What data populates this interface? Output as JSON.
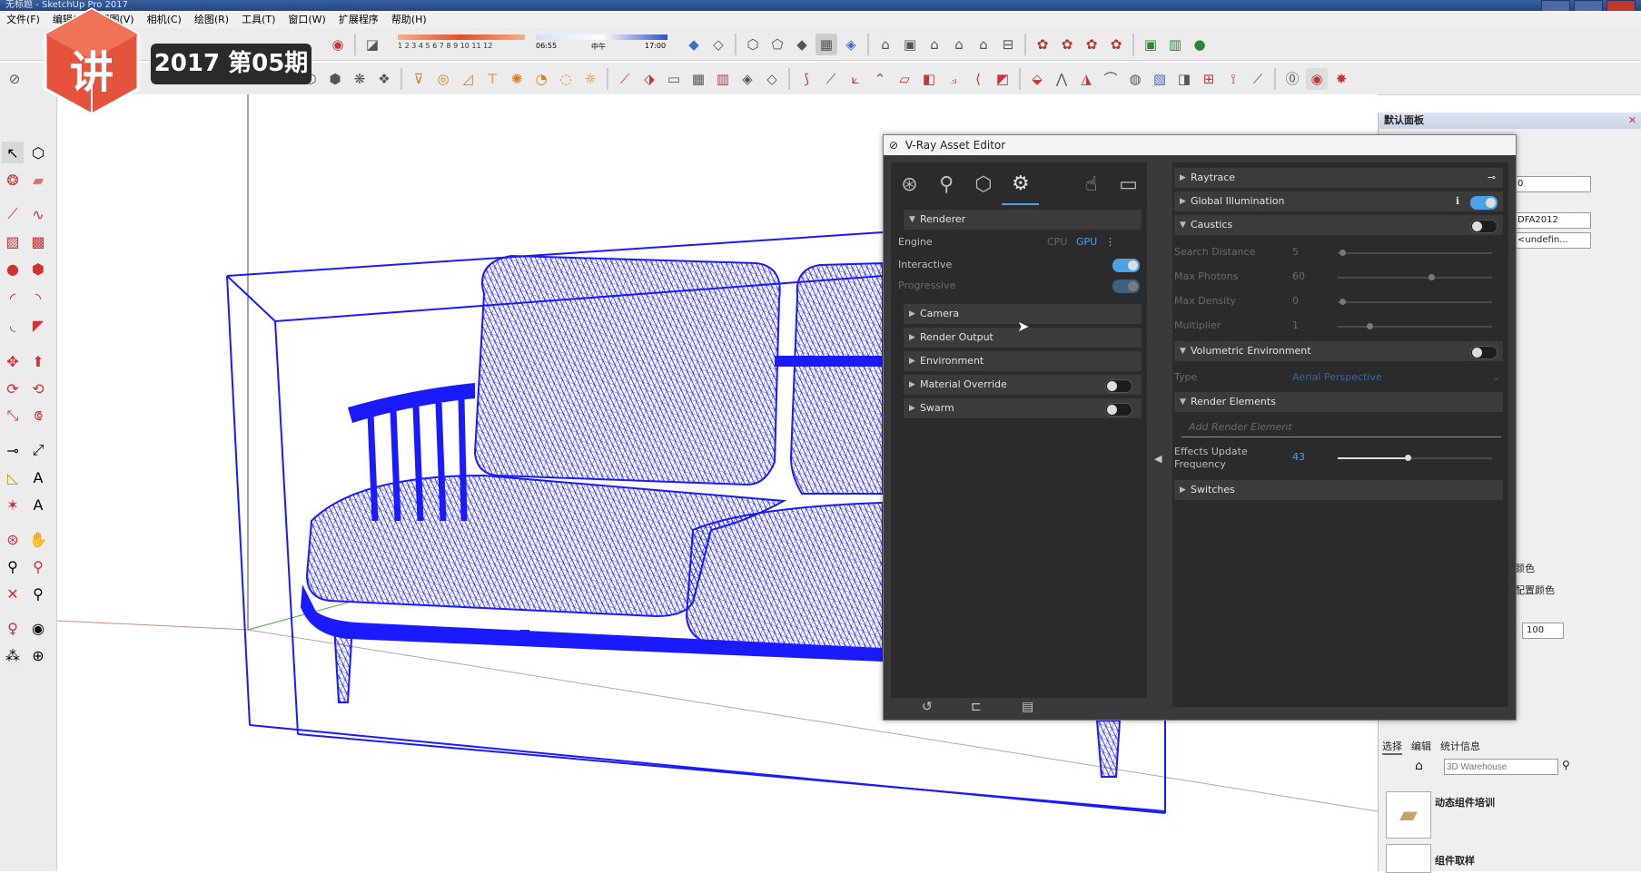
{
  "window": {
    "title": "无标题 - SketchUp Pro 2017"
  },
  "menu": [
    "文件(F)",
    "编辑(E)",
    "视图(V)",
    "相机(C)",
    "绘图(R)",
    "工具(T)",
    "窗口(W)",
    "扩展程序",
    "帮助(H)"
  ],
  "badge": {
    "text": "2017 第05期"
  },
  "logo": {
    "text": "讲"
  },
  "shadow_bar": {
    "months": "1 2 3 4 5 6 7 8 9 10 11 12",
    "time_start": "06:55",
    "time_mid": "中午",
    "time_end": "17:00"
  },
  "tray": {
    "title": "默认面板",
    "fields": [
      "0",
      "DFA2012",
      "<undefin..."
    ],
    "color_labels": [
      "颜色",
      "配置颜色"
    ],
    "spin_value": "100",
    "tabs": [
      "选择",
      "编辑",
      "统计信息"
    ],
    "search_placeholder": "3D Warehouse",
    "components": [
      "动态组件培训",
      "组件取样"
    ]
  },
  "vray": {
    "title": "V-Ray Asset Editor",
    "left_sections": {
      "renderer": "Renderer",
      "engine_label": "Engine",
      "engine_cpu": "CPU",
      "engine_gpu": "GPU",
      "interactive": "Interactive",
      "progressive": "Progressive",
      "camera": "Camera",
      "render_output": "Render Output",
      "environment": "Environment",
      "material_override": "Material Override",
      "swarm": "Swarm"
    },
    "right_sections": {
      "raytrace": "Raytrace",
      "gi": "Global Illumination",
      "caustics": "Caustics",
      "search_distance": "Search Distance",
      "search_distance_val": "5",
      "max_photons": "Max Photons",
      "max_photons_val": "60",
      "max_density": "Max Density",
      "max_density_val": "0",
      "multiplier": "Multiplier",
      "multiplier_val": "1",
      "volumetric": "Volumetric Environment",
      "type_label": "Type",
      "type_val": "Aerial Perspective",
      "render_elements": "Render Elements",
      "add_render_element": "Add Render Element",
      "effects_update": "Effects Update",
      "frequency": "Frequency",
      "effects_val": "43",
      "switches": "Switches"
    }
  },
  "colors": {
    "accent": "#4aa3e8",
    "wireframe": "#1a1aff",
    "panel": "#2b2b2b"
  }
}
